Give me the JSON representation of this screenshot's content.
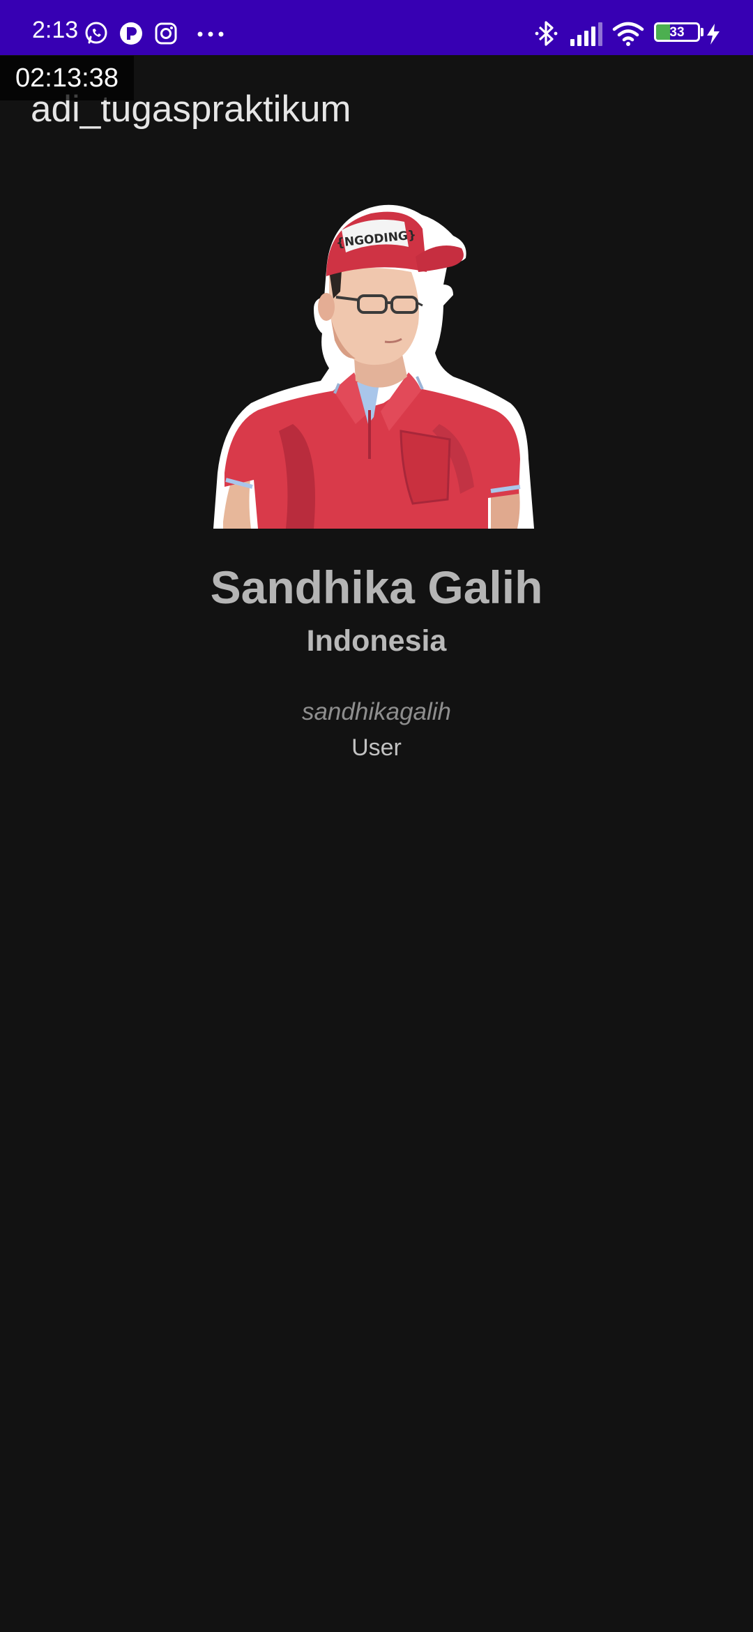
{
  "status_bar": {
    "time": "2:13",
    "battery_level": "33",
    "battery_fraction": 0.33,
    "background_color": "#3700b3",
    "notification_icons": [
      "whatsapp-icon",
      "messenger-icon",
      "instagram-icon",
      "more-icon"
    ],
    "system_icons": [
      "bluetooth-icon",
      "signal-icon",
      "wifi-icon",
      "battery-icon",
      "charging-icon"
    ]
  },
  "overlay": {
    "clock": "02:13:38"
  },
  "app_bar": {
    "title": "adi_tugaspraktikum"
  },
  "profile": {
    "image": "profile-illustration",
    "name": "Sandhika Galih",
    "country": "Indonesia",
    "username": "sandhikagalih",
    "role": "User",
    "cap_text": "{NGODING}"
  },
  "colors": {
    "background": "#121212",
    "status_bar": "#3700b3",
    "shirt": "#d93a4a",
    "text_primary": "#b5b5b5"
  }
}
